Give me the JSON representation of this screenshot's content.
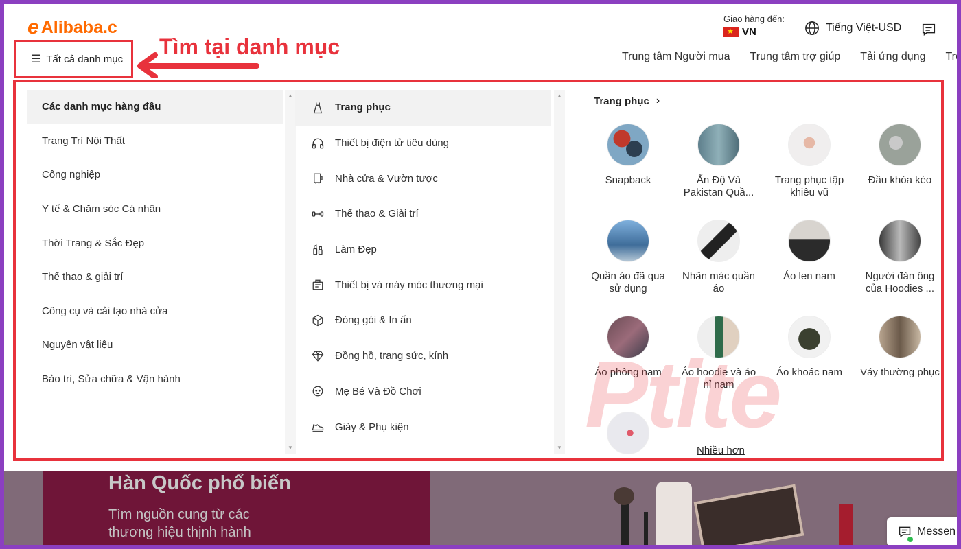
{
  "header": {
    "logo_text": "Alibaba.c",
    "ship_label": "Giao hàng đến:",
    "ship_country": "VN",
    "language": "Tiếng Việt-USD",
    "all_categories": "Tất cả danh mục",
    "annotation": "Tìm tại danh mục",
    "nav": [
      "Trung tâm Người mua",
      "Trung tâm trợ giúp",
      "Tải ứng dụng",
      "Trở t"
    ]
  },
  "menu": {
    "left_items": [
      "Các danh mục hàng đầu",
      "Trang Trí Nội Thất",
      "Công nghiệp",
      "Y tế & Chăm sóc Cá nhân",
      "Thời Trang & Sắc Đẹp",
      "Thể thao & giải trí",
      "Công cụ và cải tạo nhà cửa",
      "Nguyên vật liệu",
      "Bảo trì, Sửa chữa & Vận hành"
    ],
    "middle_items": [
      {
        "label": "Trang phục",
        "icon": "dress-icon"
      },
      {
        "label": "Thiết bị điện tử tiêu dùng",
        "icon": "headphones-icon"
      },
      {
        "label": "Nhà cửa & Vườn tược",
        "icon": "home-appliance-icon"
      },
      {
        "label": "Thể thao & Giải trí",
        "icon": "dumbbell-icon"
      },
      {
        "label": "Làm Đẹp",
        "icon": "cosmetics-icon"
      },
      {
        "label": "Thiết bị và máy móc thương mại",
        "icon": "register-icon"
      },
      {
        "label": "Đóng gói & In ấn",
        "icon": "box-icon"
      },
      {
        "label": "Đồng hồ, trang sức, kính",
        "icon": "diamond-icon"
      },
      {
        "label": "Mẹ Bé Và Đồ Chơi",
        "icon": "baby-icon"
      },
      {
        "label": "Giày & Phụ kiện",
        "icon": "shoe-icon"
      }
    ],
    "right_title": "Trang phục",
    "subcategories": [
      "Snapback",
      "Ấn Độ Và Pakistan Quầ...",
      "Trang phục tập khiêu vũ",
      "Đầu khóa kéo",
      "Quần áo đã qua sử dụng",
      "Nhãn mác quần áo",
      "Áo len nam",
      "Người đàn ông của Hoodies ...",
      "Áo phông nam",
      "Áo hoodie và áo nỉ nam",
      "Áo khoác nam",
      "Váy thường phục",
      ""
    ],
    "more_link": "Nhiều hơn"
  },
  "watermark": "Ptite",
  "banner": {
    "title": "Hàn Quốc phổ biến",
    "subtitle_line1": "Tìm nguồn cung từ các",
    "subtitle_line2": "thương hiệu thịnh hành"
  },
  "chat": {
    "label": "Messen"
  },
  "colors": {
    "brand": "#ff6a00",
    "annotation_red": "#e8323c",
    "frame_purple": "#8b3fc0"
  }
}
